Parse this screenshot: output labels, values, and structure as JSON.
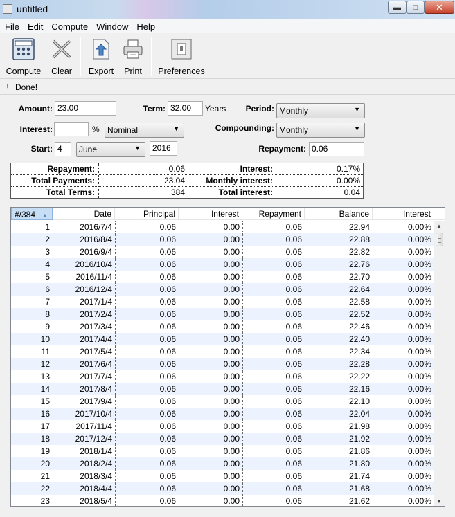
{
  "window": {
    "title": "untitled"
  },
  "menu": [
    "File",
    "Edit",
    "Compute",
    "Window",
    "Help"
  ],
  "toolbar": {
    "compute": "Compute",
    "clear": "Clear",
    "export": "Export",
    "print": "Print",
    "preferences": "Preferences"
  },
  "status": {
    "icon": "!",
    "message": "Done!"
  },
  "form": {
    "amount_label": "Amount:",
    "amount_value": "23.00",
    "term_label": "Term:",
    "term_value": "32.00",
    "term_unit": "Years",
    "period_label": "Period:",
    "period_value": "Monthly",
    "interest_label": "Interest:",
    "interest_value": "",
    "percent": "%",
    "rate_type": "Nominal",
    "compounding_label": "Compounding:",
    "compounding_value": "Monthly",
    "start_label": "Start:",
    "start_day": "4",
    "start_month": "June",
    "start_year": "2016",
    "repayment_label": "Repayment:",
    "repayment_value": "0.06"
  },
  "summary": {
    "repayment_label": "Repayment:",
    "repayment_value": "0.06",
    "interest_label": "Interest:",
    "interest_value": "0.17%",
    "total_payments_label": "Total Payments:",
    "total_payments_value": "23.04",
    "monthly_interest_label": "Monthly interest:",
    "monthly_interest_value": "0.00%",
    "total_terms_label": "Total Terms:",
    "total_terms_value": "384",
    "total_interest_label": "Total interest:",
    "total_interest_value": "0.04"
  },
  "grid": {
    "headers": [
      "#/384",
      "Date",
      "Principal",
      "Interest",
      "Repayment",
      "Balance",
      "Interest"
    ],
    "rows": [
      [
        "1",
        "2016/7/4",
        "0.06",
        "0.00",
        "0.06",
        "22.94",
        "0.00%"
      ],
      [
        "2",
        "2016/8/4",
        "0.06",
        "0.00",
        "0.06",
        "22.88",
        "0.00%"
      ],
      [
        "3",
        "2016/9/4",
        "0.06",
        "0.00",
        "0.06",
        "22.82",
        "0.00%"
      ],
      [
        "4",
        "2016/10/4",
        "0.06",
        "0.00",
        "0.06",
        "22.76",
        "0.00%"
      ],
      [
        "5",
        "2016/11/4",
        "0.06",
        "0.00",
        "0.06",
        "22.70",
        "0.00%"
      ],
      [
        "6",
        "2016/12/4",
        "0.06",
        "0.00",
        "0.06",
        "22.64",
        "0.00%"
      ],
      [
        "7",
        "2017/1/4",
        "0.06",
        "0.00",
        "0.06",
        "22.58",
        "0.00%"
      ],
      [
        "8",
        "2017/2/4",
        "0.06",
        "0.00",
        "0.06",
        "22.52",
        "0.00%"
      ],
      [
        "9",
        "2017/3/4",
        "0.06",
        "0.00",
        "0.06",
        "22.46",
        "0.00%"
      ],
      [
        "10",
        "2017/4/4",
        "0.06",
        "0.00",
        "0.06",
        "22.40",
        "0.00%"
      ],
      [
        "11",
        "2017/5/4",
        "0.06",
        "0.00",
        "0.06",
        "22.34",
        "0.00%"
      ],
      [
        "12",
        "2017/6/4",
        "0.06",
        "0.00",
        "0.06",
        "22.28",
        "0.00%"
      ],
      [
        "13",
        "2017/7/4",
        "0.06",
        "0.00",
        "0.06",
        "22.22",
        "0.00%"
      ],
      [
        "14",
        "2017/8/4",
        "0.06",
        "0.00",
        "0.06",
        "22.16",
        "0.00%"
      ],
      [
        "15",
        "2017/9/4",
        "0.06",
        "0.00",
        "0.06",
        "22.10",
        "0.00%"
      ],
      [
        "16",
        "2017/10/4",
        "0.06",
        "0.00",
        "0.06",
        "22.04",
        "0.00%"
      ],
      [
        "17",
        "2017/11/4",
        "0.06",
        "0.00",
        "0.06",
        "21.98",
        "0.00%"
      ],
      [
        "18",
        "2017/12/4",
        "0.06",
        "0.00",
        "0.06",
        "21.92",
        "0.00%"
      ],
      [
        "19",
        "2018/1/4",
        "0.06",
        "0.00",
        "0.06",
        "21.86",
        "0.00%"
      ],
      [
        "20",
        "2018/2/4",
        "0.06",
        "0.00",
        "0.06",
        "21.80",
        "0.00%"
      ],
      [
        "21",
        "2018/3/4",
        "0.06",
        "0.00",
        "0.06",
        "21.74",
        "0.00%"
      ],
      [
        "22",
        "2018/4/4",
        "0.06",
        "0.00",
        "0.06",
        "21.68",
        "0.00%"
      ],
      [
        "23",
        "2018/5/4",
        "0.06",
        "0.00",
        "0.06",
        "21.62",
        "0.00%"
      ]
    ]
  },
  "icons": {
    "compute": "calculator-icon",
    "clear": "x-icon",
    "export": "export-arrow-icon",
    "print": "printer-icon",
    "preferences": "switch-icon"
  }
}
